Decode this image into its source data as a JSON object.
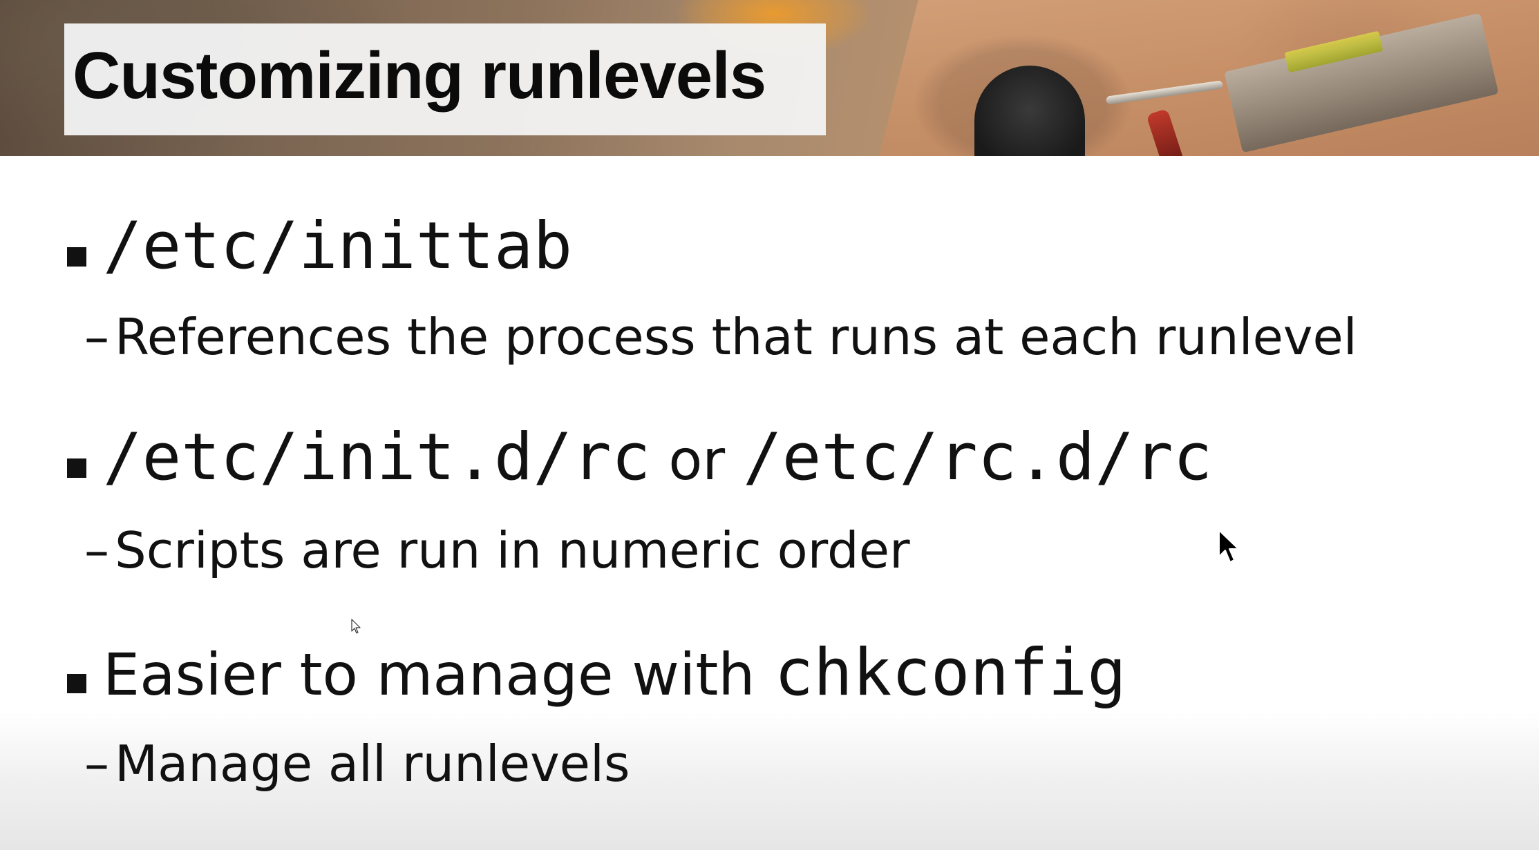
{
  "slide": {
    "title": "Customizing runlevels",
    "bullets": [
      {
        "parts": [
          {
            "text": "/etc/inittab",
            "style": "code"
          }
        ],
        "sub": {
          "dash": "–",
          "text": "References the process that runs at each runlevel"
        }
      },
      {
        "parts": [
          {
            "text": "/etc/init.d/rc",
            "style": "code"
          },
          {
            "text": "or",
            "style": "text"
          },
          {
            "text": "/etc/rc.d/rc",
            "style": "code"
          }
        ],
        "sub": {
          "dash": "–",
          "text": "Scripts are run in numeric order"
        }
      },
      {
        "parts": [
          {
            "text": "Easier to manage with",
            "style": "text"
          },
          {
            "text": "chkconfig",
            "style": "code"
          }
        ],
        "sub": {
          "dash": "–",
          "text": "Manage all runlevels"
        }
      }
    ]
  },
  "icons": {
    "bullet_marker": "square-bullet-icon",
    "cursor_large": "arrow-cursor-icon",
    "cursor_small": "arrow-cursor-outline-icon"
  },
  "colors": {
    "title_box": "#f2f2f2",
    "text": "#111111",
    "background": "#ffffff"
  }
}
